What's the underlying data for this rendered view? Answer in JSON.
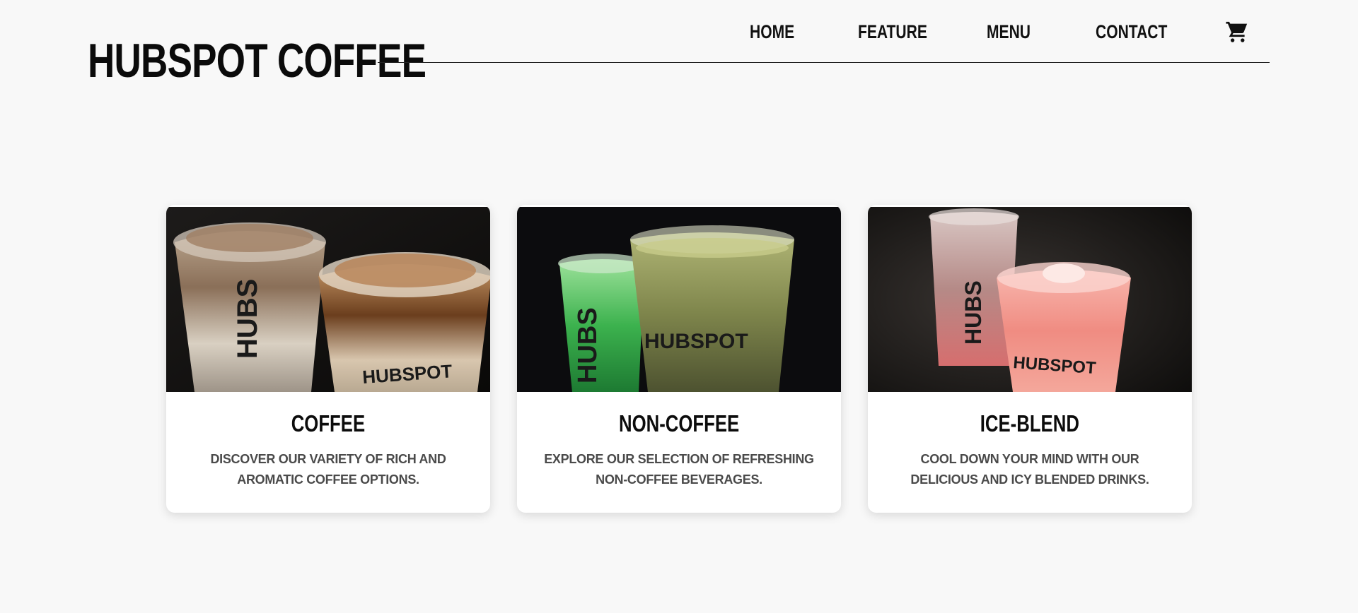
{
  "header": {
    "brand": "HUBSPOT COFFEE",
    "nav": [
      {
        "label": "HOME"
      },
      {
        "label": "FEATURE"
      },
      {
        "label": "MENU"
      },
      {
        "label": "CONTACT"
      }
    ],
    "cart_icon": "cart-icon"
  },
  "cards": [
    {
      "title": "COFFEE",
      "description": "DISCOVER OUR VARIETY OF RICH AND AROMATIC COFFEE OPTIONS.",
      "cup_text_left": "HUBS",
      "cup_text_right": "HUBSPOT"
    },
    {
      "title": "NON-COFFEE",
      "description": "EXPLORE OUR SELECTION OF REFRESHING NON-COFFEE BEVERAGES.",
      "cup_text_left": "HUBS",
      "cup_text_right": "HUBSPOT"
    },
    {
      "title": "ICE-BLEND",
      "description": "COOL DOWN YOUR MIND WITH OUR DELICIOUS AND ICY BLENDED DRINKS.",
      "cup_text_left": "HUBS",
      "cup_text_right": "HUBSPOT"
    }
  ],
  "colors": {
    "background": "#f8f8f8",
    "text_primary": "#0b0b0b",
    "text_secondary": "#4a4a4a",
    "card_bg": "#ffffff"
  }
}
